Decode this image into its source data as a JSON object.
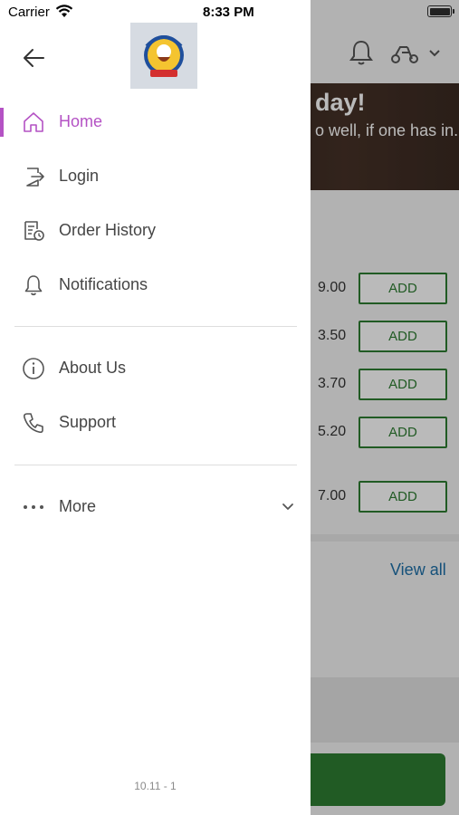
{
  "status_bar": {
    "carrier": "Carrier",
    "time": "8:33 PM"
  },
  "drawer": {
    "menu": [
      {
        "label": "Home",
        "icon": "home-icon",
        "active": true
      },
      {
        "label": "Login",
        "icon": "login-icon",
        "active": false
      },
      {
        "label": "Order History",
        "icon": "order-history-icon",
        "active": false
      },
      {
        "label": "Notifications",
        "icon": "bell-icon",
        "active": false
      }
    ],
    "secondary": [
      {
        "label": "About Us",
        "icon": "info-icon"
      },
      {
        "label": "Support",
        "icon": "phone-icon"
      }
    ],
    "more_label": "More",
    "version": "10.11 - 1",
    "accent_color": "#b452c4"
  },
  "background": {
    "hero_title": "day!",
    "hero_subtitle": "o well, if one has in.",
    "items": [
      {
        "price": "9.00",
        "button": "ADD"
      },
      {
        "price": "3.50",
        "button": "ADD"
      },
      {
        "price": "3.70",
        "button": "ADD"
      },
      {
        "price": "5.20",
        "button": "ADD"
      },
      {
        "price": "7.00",
        "button": "ADD"
      }
    ],
    "view_all": "View all",
    "add_color": "#2e7d32"
  }
}
